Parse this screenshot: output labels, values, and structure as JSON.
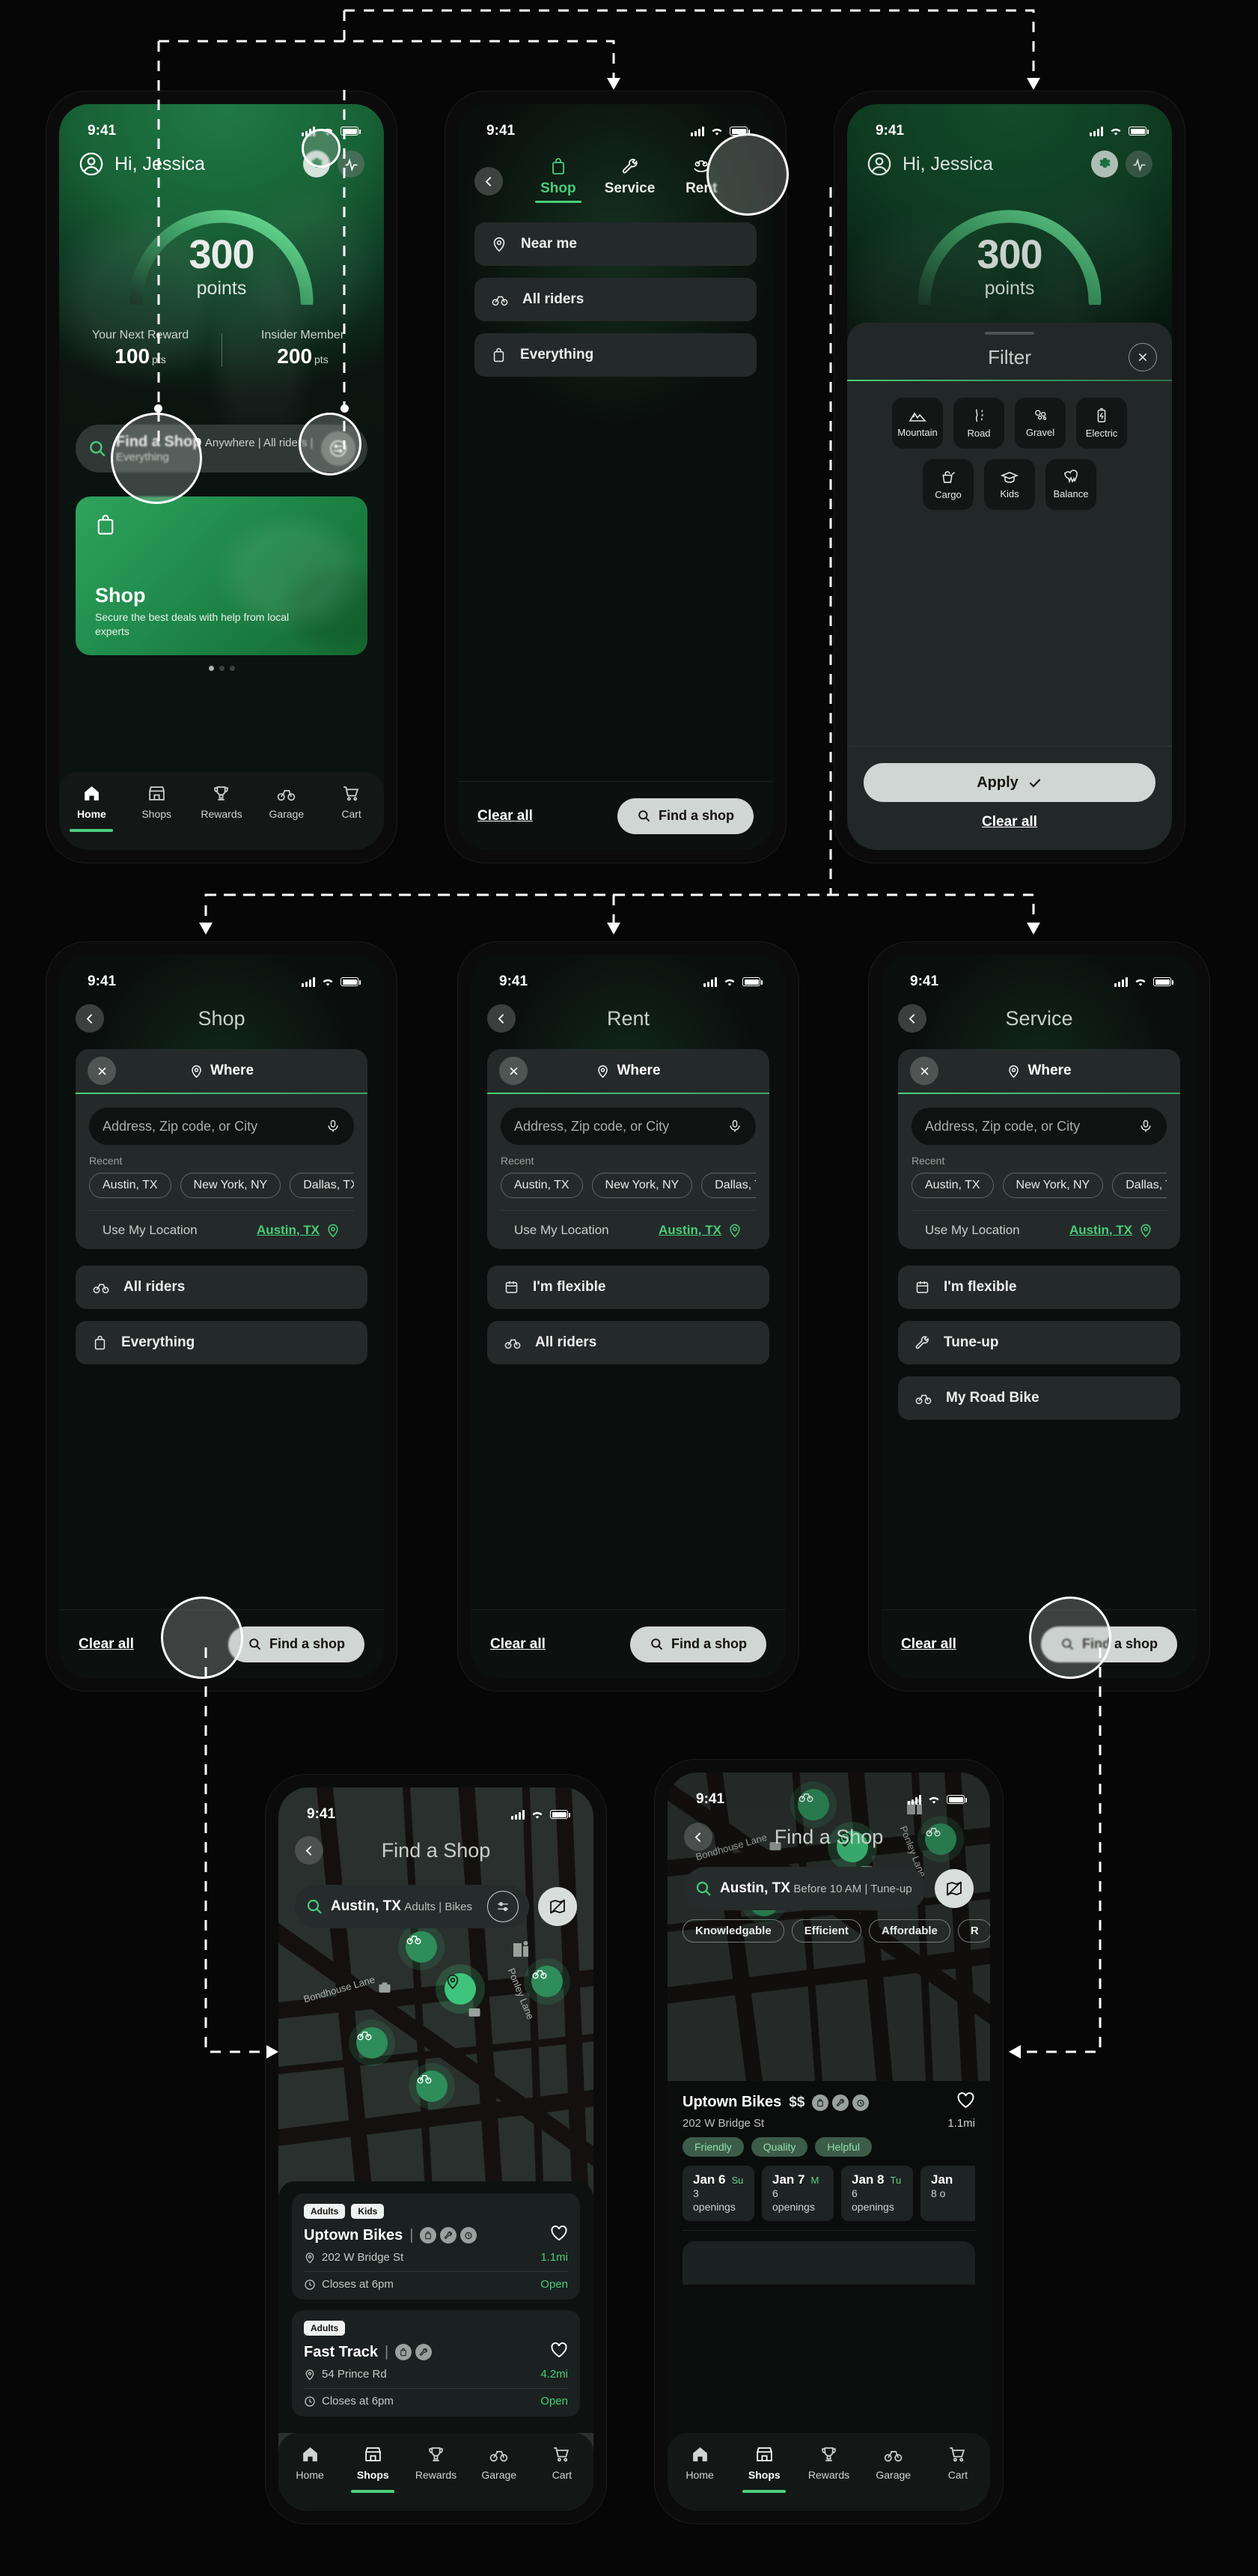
{
  "meta": {
    "status_time": "9:41"
  },
  "home": {
    "greeting": "Hi, Jessica",
    "points_value": "300",
    "points_label": "points",
    "stats": [
      {
        "caption": "Your Next Reward",
        "value": "100",
        "unit": "pts"
      },
      {
        "caption": "Insider Member",
        "value": "200",
        "unit": "pts"
      }
    ],
    "search": {
      "title": "Find a Shop",
      "subtitle": "Anywhere  |  All riders  |  Everything"
    },
    "promo": {
      "title": "Shop",
      "subtitle": "Secure the best deals with help from local experts"
    },
    "nav": [
      {
        "label": "Home",
        "icon": "home-icon",
        "active": true
      },
      {
        "label": "Shops",
        "icon": "store-icon",
        "active": false
      },
      {
        "label": "Rewards",
        "icon": "trophy-icon",
        "active": false
      },
      {
        "label": "Garage",
        "icon": "bike-icon",
        "active": false
      },
      {
        "label": "Cart",
        "icon": "cart-icon",
        "active": false
      }
    ]
  },
  "tabs_screen": {
    "tabs": [
      {
        "label": "Shop",
        "icon": "bag-icon",
        "active": true
      },
      {
        "label": "Service",
        "icon": "wrench-icon",
        "active": false
      },
      {
        "label": "Rent",
        "icon": "hand-bike-icon",
        "active": false
      }
    ],
    "options": [
      {
        "label": "Near me",
        "icon": "pin-icon"
      },
      {
        "label": "All riders",
        "icon": "bike-icon"
      },
      {
        "label": "Everything",
        "icon": "bag-icon"
      }
    ],
    "footer": {
      "clear": "Clear all",
      "cta": "Find a shop"
    }
  },
  "filter": {
    "title": "Filter",
    "row1": [
      {
        "label": "Mountain",
        "icon": "mountain-icon"
      },
      {
        "label": "Road",
        "icon": "road-icon"
      },
      {
        "label": "Gravel",
        "icon": "gravel-icon"
      },
      {
        "label": "Electric",
        "icon": "battery-icon"
      }
    ],
    "row2": [
      {
        "label": "Cargo",
        "icon": "cargo-icon"
      },
      {
        "label": "Kids",
        "icon": "kids-icon"
      },
      {
        "label": "Balance",
        "icon": "balance-icon"
      }
    ],
    "apply": "Apply",
    "clear": "Clear all"
  },
  "where_screens": [
    {
      "title": "Shop",
      "panel": {
        "label": "Where",
        "placeholder": "Address, Zip code, or City",
        "recent_label": "Recent",
        "recents": [
          "Austin, TX",
          "New York, NY",
          "Dallas, TX"
        ],
        "use_location_label": "Use My Location",
        "use_location_value": "Austin, TX"
      },
      "options": [
        {
          "label": "All riders",
          "icon": "bike-icon"
        },
        {
          "label": "Everything",
          "icon": "bag-icon"
        }
      ],
      "footer": {
        "clear": "Clear all",
        "cta": "Find a shop"
      }
    },
    {
      "title": "Rent",
      "panel": {
        "label": "Where",
        "placeholder": "Address, Zip code, or City",
        "recent_label": "Recent",
        "recents": [
          "Austin, TX",
          "New York, NY",
          "Dallas, TX"
        ],
        "use_location_label": "Use My Location",
        "use_location_value": "Austin, TX"
      },
      "options": [
        {
          "label": "I'm flexible",
          "icon": "calendar-icon"
        },
        {
          "label": "All riders",
          "icon": "bike-icon"
        }
      ],
      "footer": {
        "clear": "Clear all",
        "cta": "Find a shop"
      }
    },
    {
      "title": "Service",
      "panel": {
        "label": "Where",
        "placeholder": "Address, Zip code, or City",
        "recent_label": "Recent",
        "recents": [
          "Austin, TX",
          "New York, NY",
          "Dallas, TX"
        ],
        "use_location_label": "Use My Location",
        "use_location_value": "Austin, TX"
      },
      "options": [
        {
          "label": "I'm flexible",
          "icon": "calendar-icon"
        },
        {
          "label": "Tune-up",
          "icon": "wrench-icon"
        },
        {
          "label": "My Road Bike",
          "icon": "bike-icon"
        }
      ],
      "footer": {
        "clear": "Clear all",
        "cta": "Find a shop"
      }
    }
  ],
  "map_screen": {
    "title": "Find a Shop",
    "search": {
      "title": "Austin, TX",
      "subtitle": "Adults  |  Bikes"
    },
    "street_labels": [
      "Bondhouse Lane",
      "Ponley Lane"
    ],
    "results": [
      {
        "badges": [
          "Adults",
          "Kids"
        ],
        "name": "Uptown Bikes",
        "services": [
          "bag-icon",
          "wrench-icon",
          "clock-icon"
        ],
        "address": "202 W Bridge St",
        "distance": "1.1mi",
        "hours": "Closes at 6pm",
        "status": "Open"
      },
      {
        "badges": [
          "Adults"
        ],
        "name": "Fast Track",
        "services": [
          "bag-icon",
          "wrench-icon"
        ],
        "address": "54 Prince Rd",
        "distance": "4.2mi",
        "hours": "Closes at 6pm",
        "status": "Open"
      }
    ],
    "nav": [
      {
        "label": "Home",
        "active": false
      },
      {
        "label": "Shops",
        "active": true
      },
      {
        "label": "Rewards",
        "active": false
      },
      {
        "label": "Garage",
        "active": false
      },
      {
        "label": "Cart",
        "active": false
      }
    ]
  },
  "detail_screen": {
    "title": "Find a Shop",
    "search": {
      "title": "Austin, TX",
      "subtitle": "Before 10 AM  |  Tune-up"
    },
    "quality_pills": [
      "Knowledgable",
      "Efficient",
      "Affordable",
      "R"
    ],
    "street_labels": [
      "Bondhouse Lane",
      "Ponley Lane"
    ],
    "shop": {
      "name": "Uptown Bikes",
      "price": "$$",
      "services": [
        "bag-icon",
        "wrench-icon",
        "clock-icon"
      ],
      "address": "202 W Bridge St",
      "distance": "1.1mi",
      "tags": [
        "Friendly",
        "Quality",
        "Helpful"
      ],
      "days": [
        {
          "date": "Jan 6",
          "weekday": "Su",
          "openings": "3 openings"
        },
        {
          "date": "Jan 7",
          "weekday": "M",
          "openings": "6 openings"
        },
        {
          "date": "Jan 8",
          "weekday": "Tu",
          "openings": "6 openings"
        },
        {
          "date": "Jan",
          "weekday": "",
          "openings": "8 o"
        }
      ]
    },
    "nav": [
      {
        "label": "Home",
        "active": false
      },
      {
        "label": "Shops",
        "active": true
      },
      {
        "label": "Rewards",
        "active": false
      },
      {
        "label": "Garage",
        "active": false
      },
      {
        "label": "Cart",
        "active": false
      }
    ]
  },
  "colors": {
    "accent": "#49cd79",
    "bg": "#060606",
    "card": "#242a29"
  }
}
